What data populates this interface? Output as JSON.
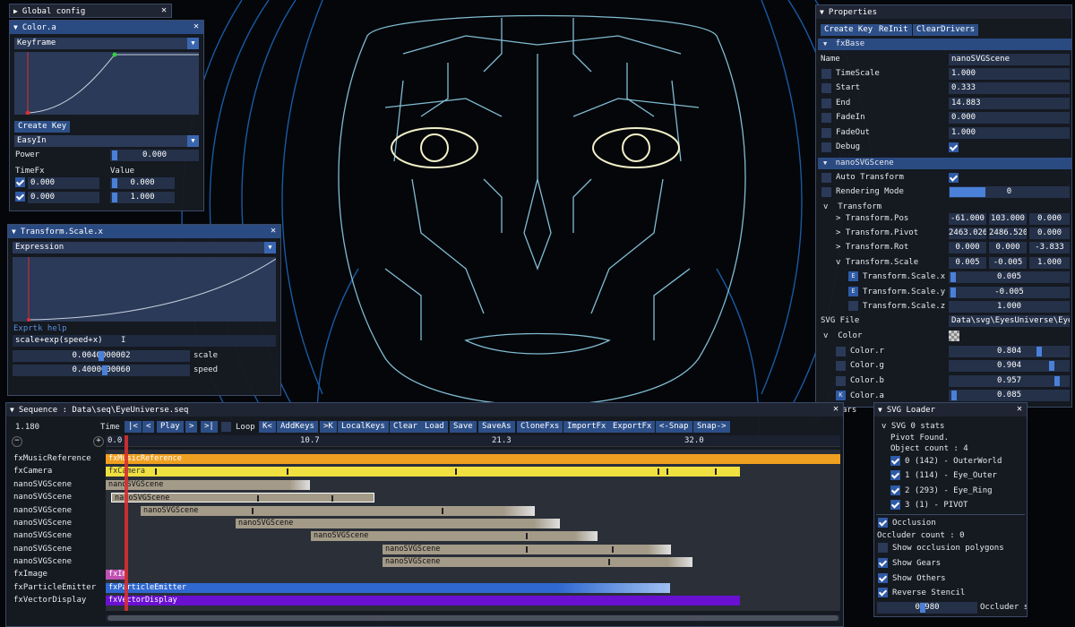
{
  "colors": {
    "accent": "#2a4a82",
    "button": "#2d4f88",
    "field": "#243149",
    "playhead": "#d83030",
    "music": "#f0a020",
    "camera": "#f0e040",
    "scene": "#a39a88",
    "image": "#c050b0",
    "emitter": "#2f68d0",
    "vector": "#6a10d0"
  },
  "global_config": {
    "title": "Global config"
  },
  "color_panel": {
    "title": "Color.a",
    "mode": "Keyframe",
    "create_key": "Create Key",
    "easing": "EasyIn",
    "power_label": "Power",
    "power_value": "0.000",
    "timefx_label": "TimeFx",
    "value_label": "Value",
    "row1": {
      "x": "0.000",
      "value": "0.000"
    },
    "row2": {
      "x": "0.000",
      "value": "1.000"
    }
  },
  "transform_panel": {
    "title": "Transform.Scale.x",
    "mode": "Expression",
    "help": "Exprtk help",
    "expression": "scale+exp(speed+x)",
    "scale_value": "0.0040000002",
    "scale_label": "scale",
    "speed_value": "0.4000000060",
    "speed_label": "speed"
  },
  "properties": {
    "title": "Properties",
    "buttons": [
      "Create Key",
      "ReInit",
      "ClearDrivers"
    ],
    "sections": {
      "fxbase": "fxBase",
      "scene": "nanoSVGScene",
      "transform": "Transform",
      "color": "Color"
    },
    "name_label": "Name",
    "name_value": "nanoSVGScene",
    "fxbase_rows": [
      {
        "label": "TimeScale",
        "value": "1.000"
      },
      {
        "label": "Start",
        "value": "0.333"
      },
      {
        "label": "End",
        "value": "14.883"
      },
      {
        "label": "FadeIn",
        "value": "0.000"
      },
      {
        "label": "FadeOut",
        "value": "1.000"
      },
      {
        "label": "Debug",
        "value": ""
      }
    ],
    "auto_transform": "Auto Transform",
    "rendering_mode": "Rendering Mode",
    "rendering_mode_value": "0",
    "pos": {
      "label": "Transform.Pos",
      "values": [
        "-61.000",
        "103.000",
        "0.000"
      ]
    },
    "pivot": {
      "label": "Transform.Pivot",
      "values": [
        "2463.026",
        "2486.520",
        "0.000"
      ]
    },
    "rot": {
      "label": "Transform.Rot",
      "values": [
        "0.000",
        "0.000",
        "-3.833"
      ]
    },
    "scale": {
      "label": "Transform.Scale",
      "values": [
        "0.005",
        "-0.005",
        "1.000"
      ]
    },
    "scale_x": {
      "label": "Transform.Scale.x",
      "value": "0.005"
    },
    "scale_y": {
      "label": "Transform.Scale.y",
      "value": "-0.005"
    },
    "scale_z": {
      "label": "Transform.Scale.z",
      "value": "1.000"
    },
    "svg_file_label": "SVG File",
    "svg_file_value": "Data\\svg\\EyesUniverse\\Eyes.",
    "color_r": {
      "label": "Color.r",
      "value": "0.804"
    },
    "color_g": {
      "label": "Color.g",
      "value": "0.904"
    },
    "color_b": {
      "label": "Color.b",
      "value": "0.957"
    },
    "color_a": {
      "label": "Color.a",
      "value": "0.085"
    },
    "gears_partial": "ars"
  },
  "svg_loader": {
    "title": "SVG Loader",
    "stats": "SVG 0 stats",
    "pivot": "Pivot Found.",
    "object_count": "Object count : 4",
    "objects": [
      "0 (142) - OuterWorld",
      "1 (114) - Eye_Outer",
      "2 (293) - Eye_Ring",
      "3 (1) - PIVOT"
    ],
    "occlusion": "Occlusion",
    "occluder_count": "Occluder count : 0",
    "show_polygons": "Show occlusion polygons",
    "show_gears": "Show Gears",
    "show_others": "Show Others",
    "reverse_stencil": "Reverse Stencil",
    "slider_value": "0.980",
    "occluder_s": "Occluder s"
  },
  "sequence": {
    "title": "Sequence : Data\\seq\\EyeUniverse.seq",
    "time_value": "1.180",
    "time_label": "Time",
    "toolbar": [
      "|<",
      "<",
      "Play",
      ">",
      ">|",
      "Loop",
      "K<",
      "AddKeys",
      ">K",
      "LocalKeys",
      "Clear",
      "Load",
      "Save",
      "SaveAs",
      "CloneFxs",
      "ImportFx",
      "ExportFx",
      "<-Snap",
      "Snap->"
    ],
    "ruler": [
      "0.0",
      "10.7",
      "21.3",
      "32.0"
    ],
    "tracks": [
      "fxMusicReference",
      "fxCamera",
      "nanoSVGScene",
      "nanoSVGScene",
      "nanoSVGScene",
      "nanoSVGScene",
      "nanoSVGScene",
      "nanoSVGScene",
      "nanoSVGScene",
      "fxImage",
      "fxParticleEmitter",
      "fxVectorDisplay"
    ],
    "clips": [
      "fxMusicReference",
      "fxCamera",
      "nanoSVGScene",
      "nanoSVGScene",
      "nanoSVGScene",
      "nanoSVGScene",
      "nanoSVGScene",
      "nanoSVGScene",
      "nanoSVGScene",
      "fxImage",
      "fxParticleEmitter",
      "fxVectorDisplay"
    ]
  }
}
